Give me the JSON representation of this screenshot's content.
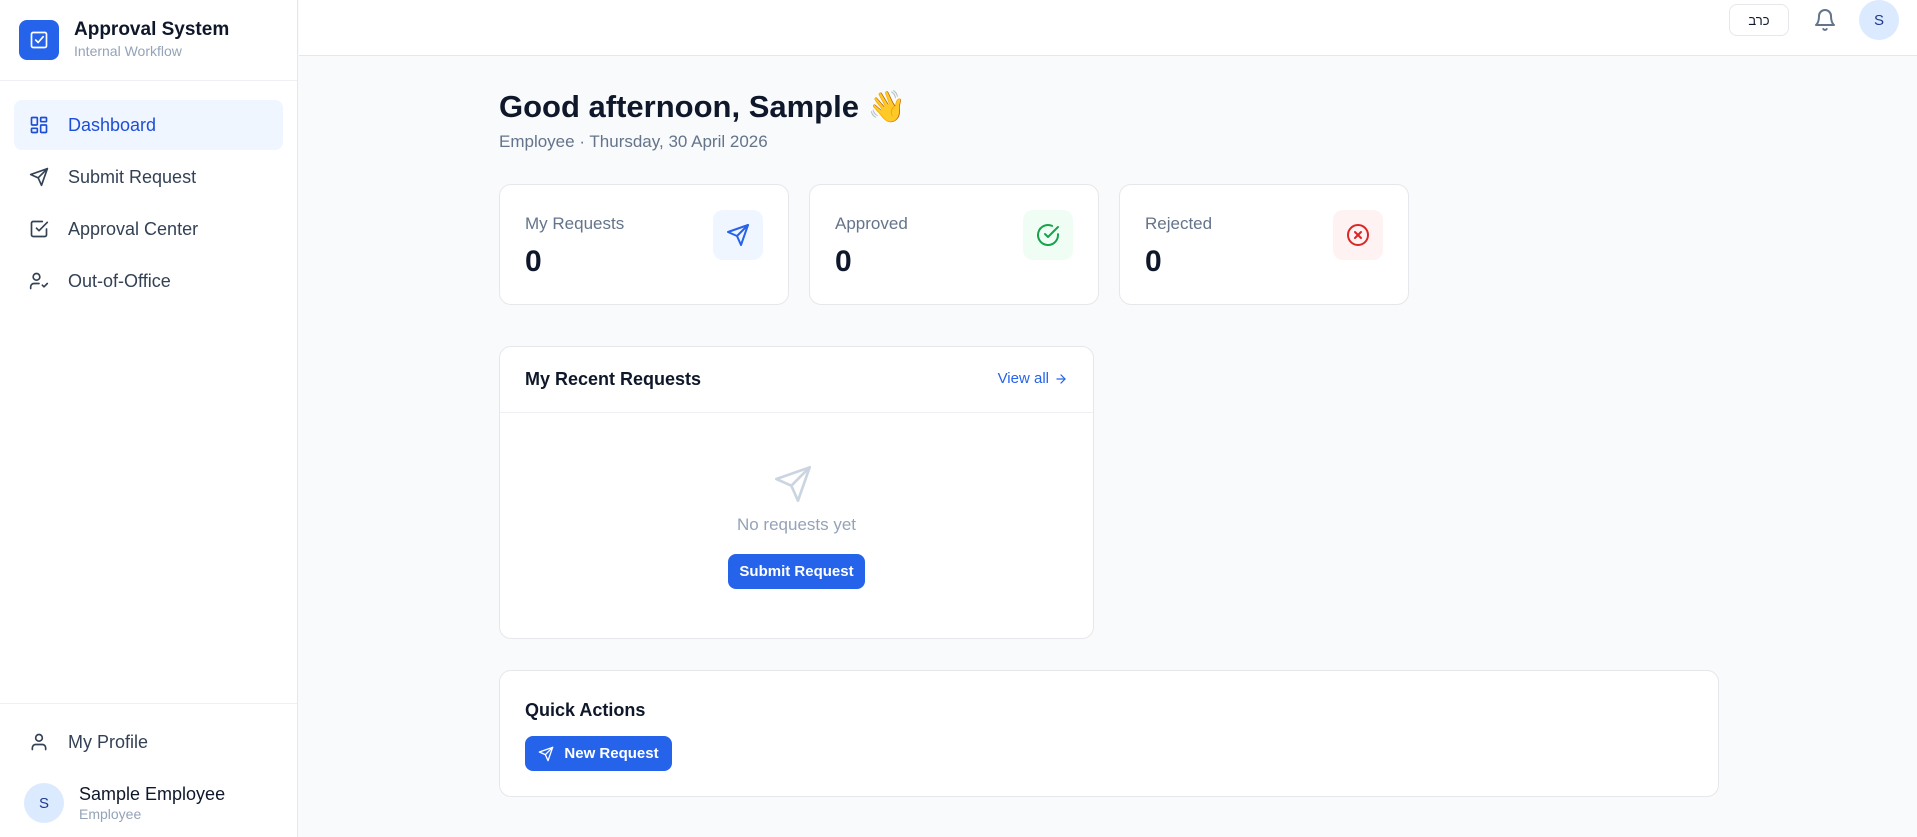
{
  "app": {
    "title": "Approval System",
    "subtitle": "Internal Workflow"
  },
  "sidebar": {
    "items": [
      {
        "label": "Dashboard",
        "icon": "dashboard-icon",
        "active": true
      },
      {
        "label": "Submit Request",
        "icon": "send-icon",
        "active": false
      },
      {
        "label": "Approval Center",
        "icon": "check-square-icon",
        "active": false
      },
      {
        "label": "Out-of-Office",
        "icon": "user-check-icon",
        "active": false
      }
    ],
    "profile_label": "My Profile",
    "user": {
      "initial": "S",
      "name": "Sample Employee",
      "role": "Employee"
    }
  },
  "topbar": {
    "language_label": "כרב",
    "avatar_initial": "S"
  },
  "greeting": {
    "title": "Good afternoon, Sample 👋",
    "subtitle": "Employee · Thursday, 30 April 2026"
  },
  "stats": [
    {
      "label": "My Requests",
      "value": "0",
      "icon": "send-icon",
      "color": "#2563eb",
      "bg": "#eff6ff"
    },
    {
      "label": "Approved",
      "value": "0",
      "icon": "check-circle-icon",
      "color": "#16a34a",
      "bg": "#f0fdf4"
    },
    {
      "label": "Rejected",
      "value": "0",
      "icon": "x-circle-icon",
      "color": "#dc2626",
      "bg": "#fef2f2"
    }
  ],
  "recent": {
    "title": "My Recent Requests",
    "view_all": "View all",
    "empty_text": "No requests yet",
    "submit_label": "Submit Request"
  },
  "quick_actions": {
    "title": "Quick Actions",
    "new_request_label": "New Request"
  },
  "colors": {
    "accent": "#2563eb"
  }
}
